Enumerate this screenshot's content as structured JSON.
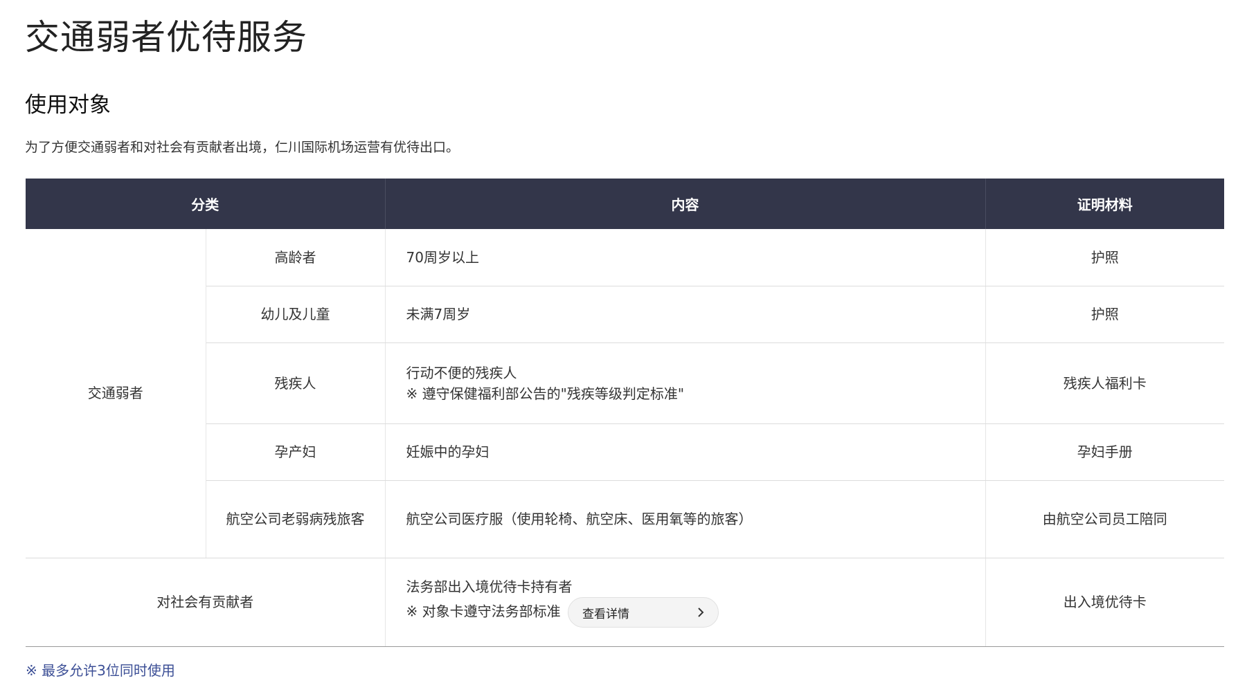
{
  "page_title": "交通弱者优待服务",
  "section_title": "使用对象",
  "intro": "为了方便交通弱者和对社会有贡献者出境，仁川国际机场运营有优待出口。",
  "table": {
    "headers": {
      "category": "分类",
      "content": "内容",
      "document": "证明材料"
    },
    "group_vulnerable": "交通弱者",
    "rows": [
      {
        "subcategory": "高龄者",
        "content": "70周岁以上",
        "document": "护照"
      },
      {
        "subcategory": "幼儿及儿童",
        "content": "未满7周岁",
        "document": "护照"
      },
      {
        "subcategory": "残疾人",
        "content": "行动不便的残疾人",
        "note": "※ 遵守保健福利部公告的\"残疾等级判定标准\"",
        "document": "残疾人福利卡"
      },
      {
        "subcategory": "孕产妇",
        "content": "妊娠中的孕妇",
        "document": "孕妇手册"
      },
      {
        "subcategory": "航空公司老弱病残旅客",
        "content": "航空公司医疗服（使用轮椅、航空床、医用氧等的旅客）",
        "document": "由航空公司员工陪同"
      }
    ],
    "contributor": {
      "category": "对社会有贡献者",
      "content": "法务部出入境优待卡持有者",
      "note": "※ 对象卡遵守法务部标准",
      "button_label": "查看详情",
      "document": "出入境优待卡"
    }
  },
  "footnote": "※ 最多允许3位同时使用",
  "colors": {
    "header_bg": "#33364a",
    "footnote": "#3c4f96",
    "button_bg": "#f4f4f4"
  },
  "icons": {
    "detail_button": "chevron-right-icon"
  }
}
